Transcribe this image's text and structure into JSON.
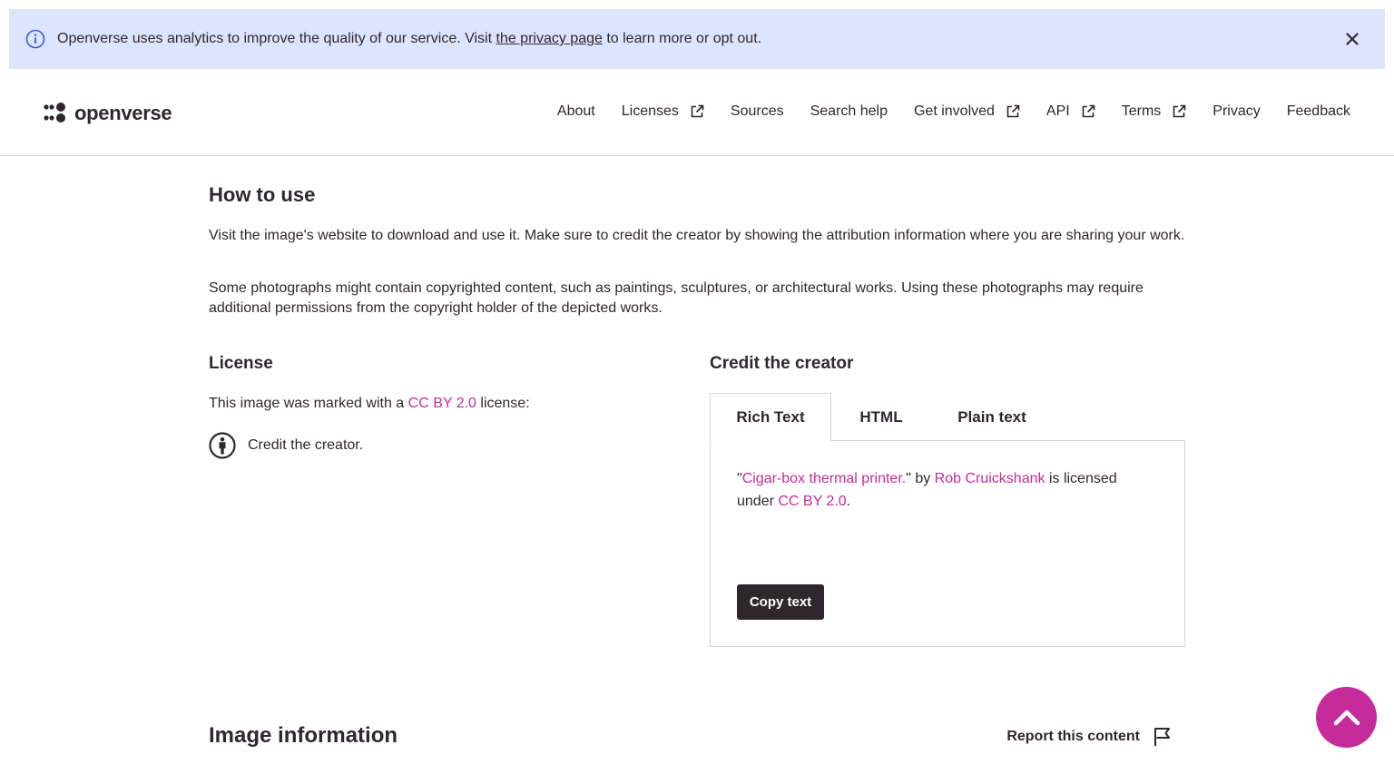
{
  "banner": {
    "text_before": "Openverse uses analytics to improve the quality of our service. Visit ",
    "link_text": "the privacy page",
    "text_after": " to learn more or opt out.",
    "info_icon": "info-icon",
    "close_icon": "close-icon"
  },
  "header": {
    "logo_text": "openverse",
    "nav": [
      {
        "label": "About",
        "external": false
      },
      {
        "label": "Licenses",
        "external": true
      },
      {
        "label": "Sources",
        "external": false
      },
      {
        "label": "Search help",
        "external": false
      },
      {
        "label": "Get involved",
        "external": true
      },
      {
        "label": "API",
        "external": true
      },
      {
        "label": "Terms",
        "external": true
      },
      {
        "label": "Privacy",
        "external": false
      },
      {
        "label": "Feedback",
        "external": false
      }
    ]
  },
  "how_to_use": {
    "title": "How to use",
    "para1": "Visit the image's website to download and use it. Make sure to credit the creator by showing the attribution information where you are sharing your work.",
    "para2": "Some photographs might contain copyrighted content, such as paintings, sculptures, or architectural works. Using these photographs may require additional permissions from the copyright holder of the depicted works."
  },
  "license": {
    "title": "License",
    "text_before": "This image was marked with a ",
    "license_link": "CC BY 2.0",
    "text_after": " license:",
    "credit_text": "Credit the creator."
  },
  "credit": {
    "title": "Credit the creator",
    "tabs": [
      "Rich Text",
      "HTML",
      "Plain text"
    ],
    "active_tab": "Rich Text",
    "quote_open": "\"",
    "work_title": "Cigar-box thermal printer.",
    "by_text": "\" by ",
    "creator": "Rob Cruickshank",
    "licensed_text": " is licensed under ",
    "license_link": "CC BY 2.0",
    "period": ".",
    "copy_button": "Copy text"
  },
  "image_info": {
    "title": "Image information",
    "report_label": "Report this content"
  },
  "colors": {
    "accent": "#c52b9b",
    "banner_bg": "#dde4fd",
    "dark": "#30272e",
    "border": "#d8d4d7"
  }
}
